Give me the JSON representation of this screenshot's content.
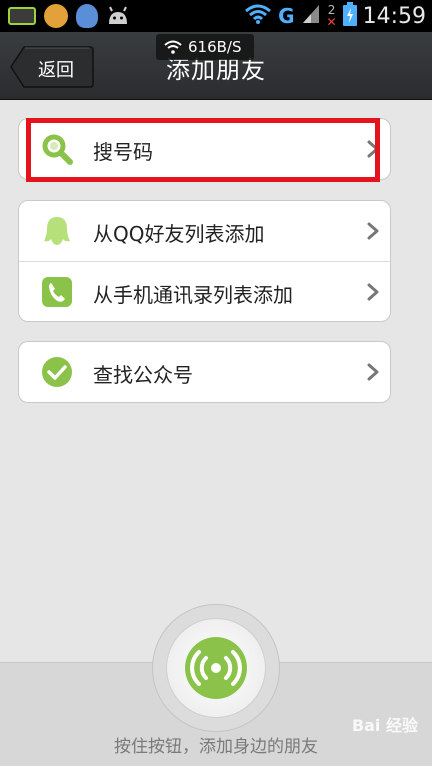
{
  "status_bar": {
    "network_speed": "616B/S",
    "network_type": "G",
    "sim_label": "2",
    "time": "14:59",
    "icons": [
      "battery-widget-icon",
      "app-icon",
      "qq-icon",
      "android-icon",
      "wifi-icon",
      "signal-icon",
      "battery-charging-icon"
    ]
  },
  "header": {
    "back_label": "返回",
    "title": "添加朋友"
  },
  "groups": [
    {
      "rows": [
        {
          "label": "搜号码",
          "icon": "search-icon"
        }
      ]
    },
    {
      "rows": [
        {
          "label": "从QQ好友列表添加",
          "icon": "qq-penguin-icon"
        },
        {
          "label": "从手机通讯录列表添加",
          "icon": "phone-icon"
        }
      ]
    },
    {
      "rows": [
        {
          "label": "查找公众号",
          "icon": "check-circle-icon"
        }
      ]
    }
  ],
  "bottom": {
    "hint": "按住按钮，添加身边的朋友",
    "button_icon": "radar-broadcast-icon"
  },
  "watermark": "Bai 经验",
  "colors": {
    "accent_green": "#8bc34a",
    "highlight_red": "#e4131c",
    "title_bar": "#2f3133"
  }
}
